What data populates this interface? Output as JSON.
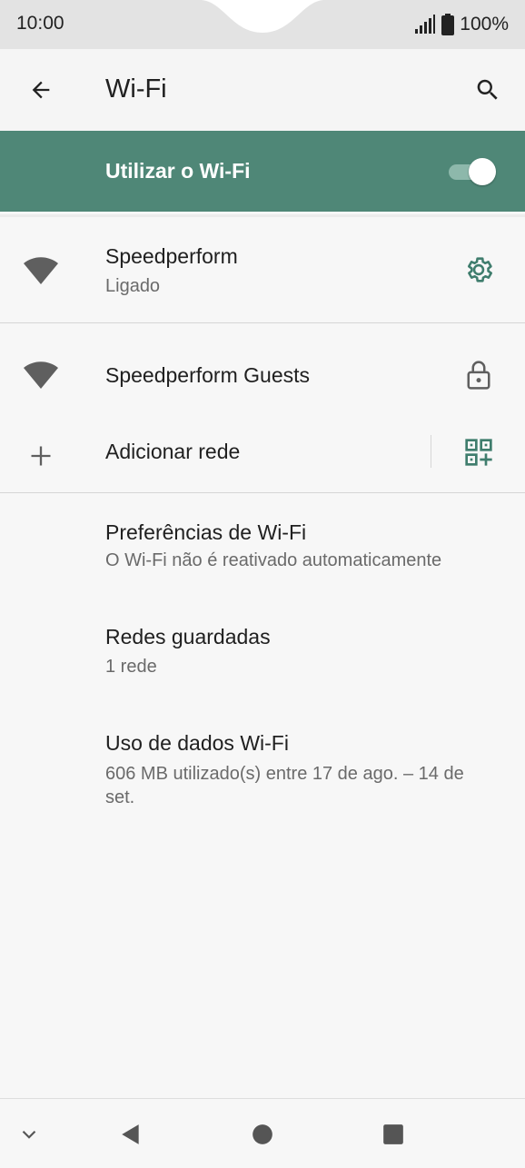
{
  "status": {
    "time": "10:00",
    "battery": "100%"
  },
  "appbar": {
    "title": "Wi-Fi"
  },
  "toggle": {
    "label": "Utilizar o Wi-Fi",
    "on": true
  },
  "connected": {
    "ssid": "Speedperform",
    "status": "Ligado"
  },
  "available": {
    "ssid": "Speedperform Guests"
  },
  "add_network": {
    "label": "Adicionar rede"
  },
  "settings": [
    {
      "title": "Preferências de Wi-Fi",
      "subtitle": "O Wi-Fi não é reativado automaticamente"
    },
    {
      "title": "Redes guardadas",
      "subtitle": "1 rede"
    },
    {
      "title": "Uso de dados Wi-Fi",
      "subtitle": "606 MB utilizado(s) entre 17 de ago. – 14 de set."
    }
  ],
  "colors": {
    "accent": "#4f8777",
    "icon_accent": "#3f7d6d",
    "icon_grey": "#6b6b6b"
  },
  "icons": {
    "back": "arrow-back-icon",
    "search": "search-icon",
    "wifi": "wifi-signal-icon",
    "gear": "gear-icon",
    "lock": "lock-icon",
    "add": "plus-icon",
    "qr": "qr-code-add-icon",
    "nav_down": "chevron-down-icon",
    "nav_back": "triangle-back-icon",
    "nav_home": "circle-home-icon",
    "nav_recents": "square-recents-icon"
  }
}
